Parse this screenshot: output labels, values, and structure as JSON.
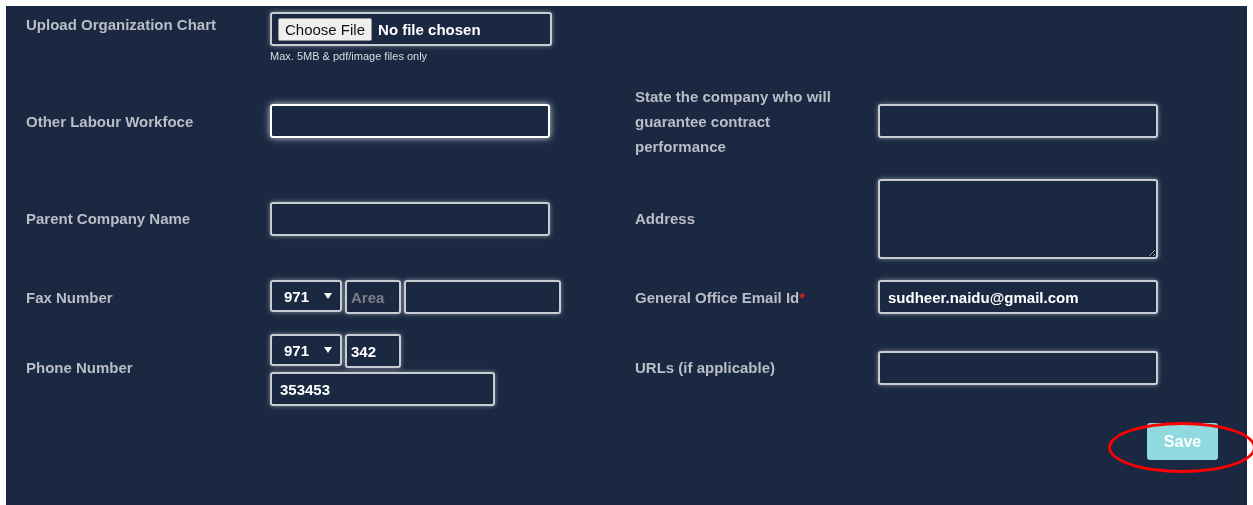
{
  "upload": {
    "label": "Upload Organization Chart",
    "button": "Choose File",
    "status": "No file chosen",
    "hint": "Max. 5MB & pdf/image files only"
  },
  "rows": [
    {
      "left": {
        "kind": "text",
        "label": "Other Labour Workfoce",
        "focused": true
      },
      "right": {
        "kind": "text",
        "label": "State the company who will guarantee contract performance",
        "focused": false
      }
    },
    {
      "left": {
        "kind": "text",
        "label": "Parent Company Name",
        "focused": false
      },
      "right": {
        "kind": "textarea",
        "label": "Address",
        "focused": false
      }
    },
    {
      "left": {
        "kind": "fax",
        "label": "Fax Number",
        "code": "971",
        "area_placeholder": "Area"
      },
      "right": {
        "kind": "text",
        "label": "General Office Email Id",
        "required_mark": "*",
        "value": "sudheer.naidu@gmail.com",
        "focused": false
      }
    },
    {
      "left": {
        "kind": "phone",
        "label": "Phone Number",
        "code": "971",
        "area": "342",
        "number": "353453"
      },
      "right": {
        "kind": "text",
        "label": "URLs (if applicable)",
        "focused": false
      }
    }
  ],
  "save": {
    "label": "Save",
    "circled": true
  }
}
